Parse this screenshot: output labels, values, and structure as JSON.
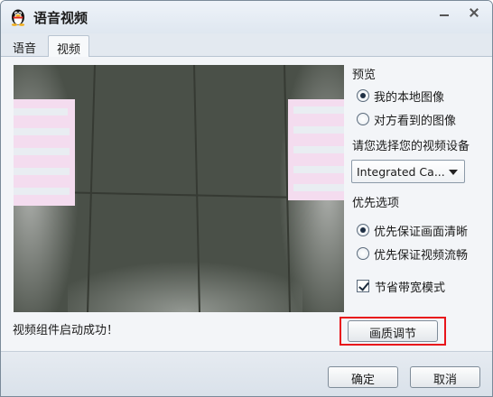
{
  "window": {
    "title": "语音视频",
    "icon": "qq-penguin-icon"
  },
  "tabs": [
    {
      "label": "语音",
      "active": false
    },
    {
      "label": "视频",
      "active": true
    }
  ],
  "preview_section": {
    "heading": "预览",
    "options": [
      {
        "label": "我的本地图像",
        "selected": true
      },
      {
        "label": "对方看到的图像",
        "selected": false
      }
    ]
  },
  "device": {
    "heading": "请您选择您的视频设备",
    "selected": "Integrated Ca..."
  },
  "priority": {
    "heading": "优先选项",
    "options": [
      {
        "label": "优先保证画面清晰",
        "selected": true
      },
      {
        "label": "优先保证视频流畅",
        "selected": false
      }
    ]
  },
  "bandwidth_saver": {
    "label": "节省带宽模式",
    "checked": true
  },
  "quality_button": {
    "label": "画质调节"
  },
  "status_text": "视频组件启动成功！",
  "footer": {
    "ok_label": "确定",
    "cancel_label": "取消"
  },
  "colors": {
    "highlight": "#e8141b",
    "titlebar": "#dfe7f0"
  }
}
